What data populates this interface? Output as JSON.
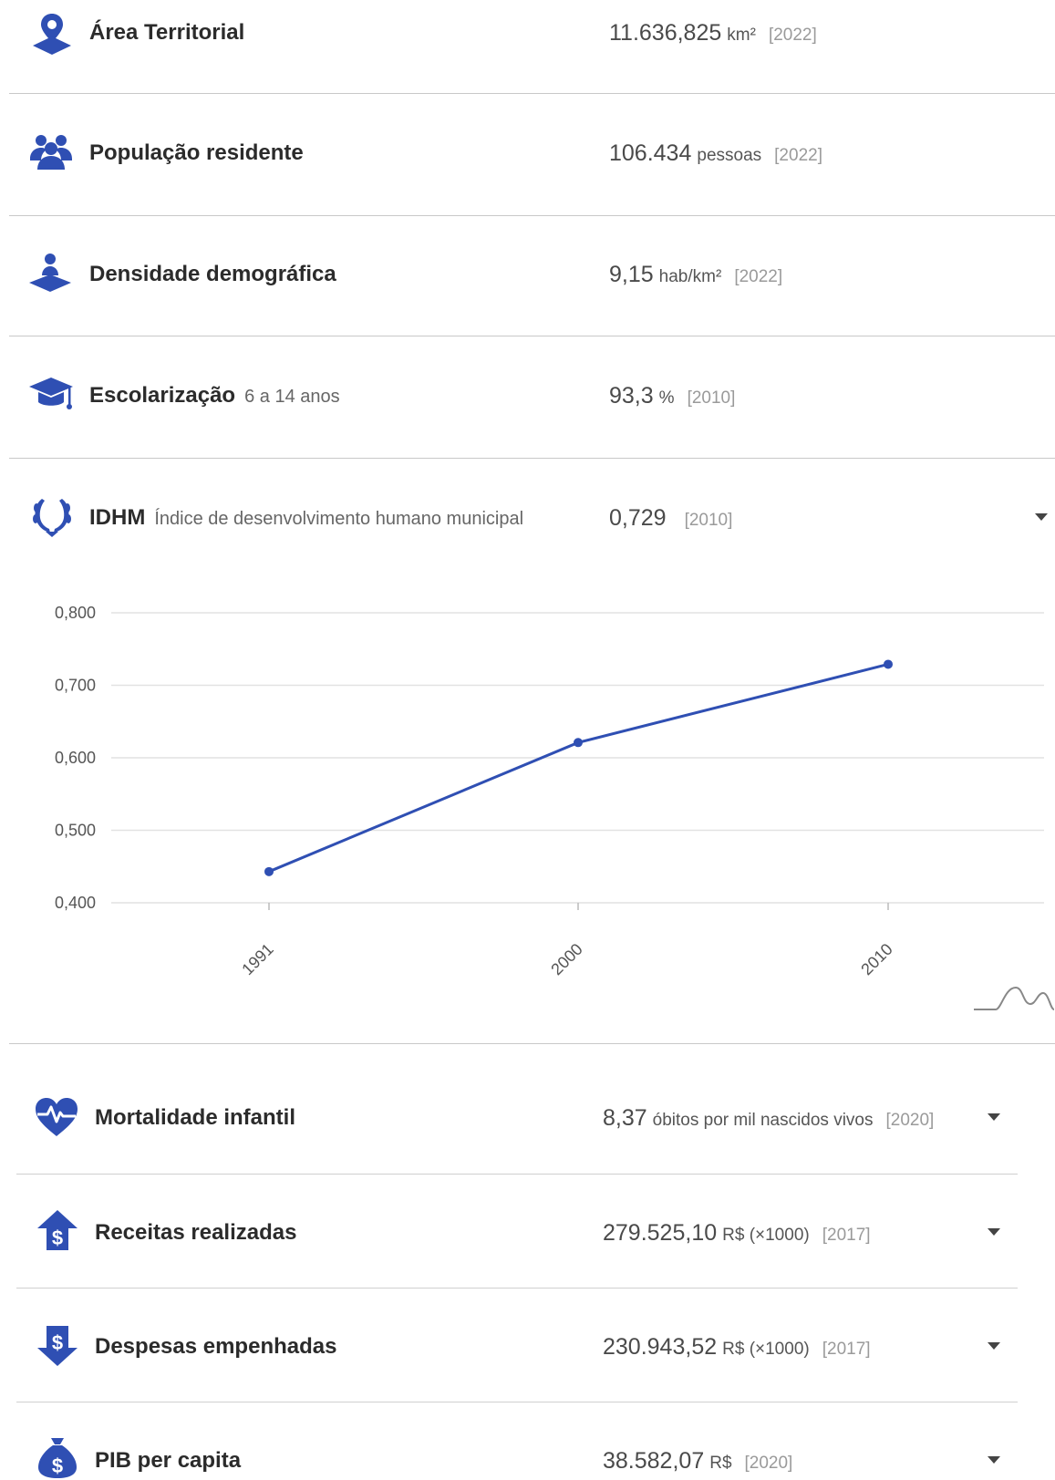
{
  "indicators": [
    {
      "label": "Área Territorial",
      "sublabel": "",
      "value": "11.636,825",
      "unit": "km²",
      "year": "[2022]",
      "icon": "map-pin-icon"
    },
    {
      "label": "População residente",
      "sublabel": "",
      "value": "106.434",
      "unit": "pessoas",
      "year": "[2022]",
      "icon": "people-icon"
    },
    {
      "label": "Densidade demográfica",
      "sublabel": "",
      "value": "9,15",
      "unit": "hab/km²",
      "year": "[2022]",
      "icon": "person-on-map-icon"
    },
    {
      "label": "Escolarização",
      "sublabel": "6 a 14 anos",
      "value": "93,3",
      "unit": "%",
      "year": "[2010]",
      "icon": "graduation-cap-icon"
    },
    {
      "label": "IDHM",
      "sublabel": "Índice de desenvolvimento humano municipal",
      "value": "0,729",
      "unit": "",
      "year": "[2010]",
      "icon": "laurel-wreath-icon"
    },
    {
      "label": "Mortalidade infantil",
      "sublabel": "",
      "value": "8,37",
      "unit": "óbitos por mil nascidos vivos",
      "year": "[2020]",
      "icon": "heart-pulse-icon"
    },
    {
      "label": "Receitas realizadas",
      "sublabel": "",
      "value": "279.525,10",
      "unit": "R$ (×1000)",
      "year": "[2017]",
      "icon": "revenue-arrow-up-icon"
    },
    {
      "label": "Despesas empenhadas",
      "sublabel": "",
      "value": "230.943,52",
      "unit": "R$ (×1000)",
      "year": "[2017]",
      "icon": "expense-arrow-down-icon"
    },
    {
      "label": "PIB per capita",
      "sublabel": "",
      "value": "38.582,07",
      "unit": "R$",
      "year": "[2020]",
      "icon": "money-bag-icon"
    }
  ],
  "colors": {
    "accent": "#2f4fb3",
    "line": "#2f4fb3",
    "grid": "#e2e2e2"
  },
  "chart_data": {
    "type": "line",
    "categories": [
      "1991",
      "2000",
      "2010"
    ],
    "series": [
      {
        "values": [
          0.443,
          0.621,
          0.729
        ]
      }
    ],
    "yticks": [
      "0,800",
      "0,700",
      "0,600",
      "0,500",
      "0,400"
    ],
    "ylim": [
      0.4,
      0.8
    ],
    "grid": true,
    "legend": "none"
  }
}
